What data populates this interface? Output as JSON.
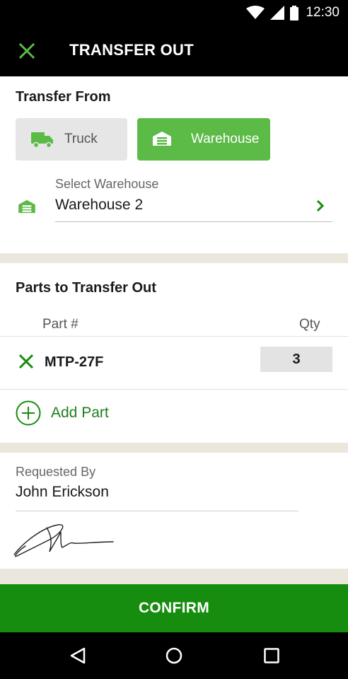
{
  "status_bar": {
    "time": "12:30",
    "icons": [
      "wifi-icon",
      "signal-icon",
      "battery-icon"
    ]
  },
  "app_bar": {
    "title": "TRANSFER OUT",
    "close_icon": "close-icon"
  },
  "transfer_from": {
    "title": "Transfer From",
    "options": [
      {
        "label": "Truck",
        "icon": "truck-icon",
        "selected": false
      },
      {
        "label": "Warehouse",
        "icon": "warehouse-icon",
        "selected": true
      }
    ],
    "select_caption": "Select Warehouse",
    "selected_warehouse": "Warehouse 2"
  },
  "parts": {
    "title": "Parts to Transfer Out",
    "columns": [
      "Part #",
      "Qty"
    ],
    "rows": [
      {
        "part": "MTP-27F",
        "qty": "3"
      }
    ],
    "add_label": "Add Part"
  },
  "requested": {
    "caption": "Requested By",
    "name": "John Erickson"
  },
  "confirm_label": "CONFIRM",
  "colors": {
    "accent_green": "#5cba47",
    "confirm_green": "#168d0e",
    "dark_green": "#1e7e1e",
    "bar_black": "#000000",
    "background": "#ece7dc"
  }
}
